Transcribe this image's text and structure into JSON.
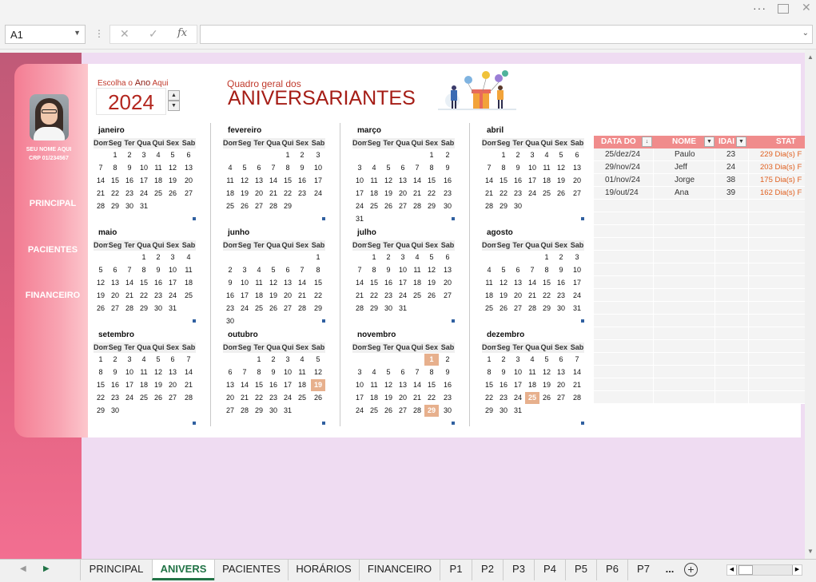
{
  "window": {
    "menu_dots": "···"
  },
  "formula_bar": {
    "name_box": "A1",
    "cancel": "✕",
    "enter": "✓",
    "fx": "fx",
    "formula": ""
  },
  "sidebar": {
    "user_name": "SEU NOME AQUI",
    "user_id": "CRP 01/234567",
    "items": [
      {
        "label": "PRINCIPAL"
      },
      {
        "label": "PACIENTES"
      },
      {
        "label": "FINANCEIRO"
      }
    ]
  },
  "header": {
    "choose_prefix": "Escolha o ",
    "choose_bold": "Ano",
    "choose_suffix": " Aqui",
    "year": "2024",
    "subtitle": "Quadro geral dos",
    "title": "ANIVERSARIANTES"
  },
  "weekdays": [
    "Dom",
    "Seg",
    "Ter",
    "Qua",
    "Qui",
    "Sex",
    "Sab"
  ],
  "months": [
    {
      "name": "janeiro",
      "start": 1,
      "days": 31,
      "highlight": []
    },
    {
      "name": "fevereiro",
      "start": 4,
      "days": 29,
      "highlight": []
    },
    {
      "name": "março",
      "start": 5,
      "days": 31,
      "highlight": []
    },
    {
      "name": "abril",
      "start": 1,
      "days": 30,
      "highlight": []
    },
    {
      "name": "maio",
      "start": 3,
      "days": 31,
      "highlight": []
    },
    {
      "name": "junho",
      "start": 6,
      "days": 30,
      "highlight": []
    },
    {
      "name": "julho",
      "start": 1,
      "days": 31,
      "highlight": []
    },
    {
      "name": "agosto",
      "start": 4,
      "days": 31,
      "highlight": []
    },
    {
      "name": "setembro",
      "start": 0,
      "days": 30,
      "highlight": []
    },
    {
      "name": "outubro",
      "start": 2,
      "days": 31,
      "highlight": [
        19
      ]
    },
    {
      "name": "novembro",
      "start": 5,
      "days": 30,
      "highlight": [
        1,
        29
      ]
    },
    {
      "name": "dezembro",
      "start": 0,
      "days": 31,
      "highlight": [
        25
      ]
    }
  ],
  "table": {
    "columns": [
      "DATA DO",
      "NOME",
      "IDAI",
      "STAT"
    ],
    "rows": [
      {
        "date": "25/dez/24",
        "name": "Paulo",
        "age": "23",
        "status": "229 Dia(s) F"
      },
      {
        "date": "29/nov/24",
        "name": "Jeff",
        "age": "24",
        "status": "203 Dia(s) F"
      },
      {
        "date": "01/nov/24",
        "name": "Jorge",
        "age": "38",
        "status": "175 Dia(s) F"
      },
      {
        "date": "19/out/24",
        "name": "Ana",
        "age": "39",
        "status": "162 Dia(s) F"
      }
    ]
  },
  "tabs": [
    {
      "label": "PRINCIPAL",
      "active": false
    },
    {
      "label": "ANIVERS",
      "active": true
    },
    {
      "label": "PACIENTES",
      "active": false
    },
    {
      "label": "HORÁRIOS",
      "active": false
    },
    {
      "label": "FINANCEIRO",
      "active": false
    },
    {
      "label": "P1",
      "active": false
    },
    {
      "label": "P2",
      "active": false
    },
    {
      "label": "P3",
      "active": false
    },
    {
      "label": "P4",
      "active": false
    },
    {
      "label": "P5",
      "active": false
    },
    {
      "label": "P6",
      "active": false
    },
    {
      "label": "P7",
      "active": false
    },
    {
      "label": "...",
      "active": false
    }
  ],
  "colors": {
    "accent": "#a51d16",
    "highlight": "#e7b08d",
    "excel_green": "#217346",
    "table_header": "#f08c8c"
  }
}
